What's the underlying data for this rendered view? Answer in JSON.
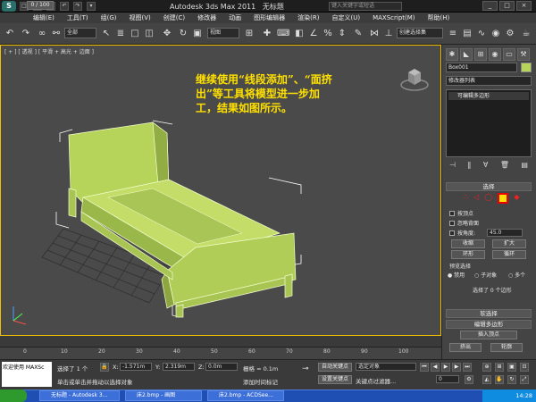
{
  "app": {
    "title": "Autodesk 3ds Max 2011",
    "doc_title": "无标题",
    "search_placeholder": "键入关键字或短语"
  },
  "menu": [
    "编辑(E)",
    "工具(T)",
    "组(G)",
    "视图(V)",
    "创建(C)",
    "修改器",
    "动画",
    "图形编辑器",
    "渲染(R)",
    "自定义(U)",
    "MAXScript(M)",
    "帮助(H)"
  ],
  "toolbar": {
    "filter_select": "全部",
    "coord_select": "视图",
    "selset_select": "创建选择集"
  },
  "viewport": {
    "label": "[ + ] [ 透视 ] [ 平滑 + 高光 + 边面 ]",
    "note_lines": [
      "继续使用“线段添加”、“面挤",
      "出”等工具将模型进一步加",
      "工，结果如图所示。"
    ]
  },
  "timeline": {
    "frame": "0 / 100",
    "ticks": [
      "0",
      "10",
      "20",
      "30",
      "40",
      "50",
      "60",
      "70",
      "80",
      "90",
      "100"
    ]
  },
  "status": {
    "welcome": "欢迎使用 MAXSc",
    "selected": "选择了 1 个",
    "x_label": "X:",
    "x_val": "-1.571m",
    "y_label": "Y:",
    "y_val": "2.319m",
    "z_label": "Z:",
    "z_val": "0.0m",
    "grid": "栅格 = 0.1m",
    "prompt": "单击或单击并拖动以选择对象",
    "add_time_tag": "添加时间标记",
    "auto_key": "自动关键点",
    "set_key": "设置关键点",
    "selected_object": "选定对象",
    "key_filters": "关键点过滤器...",
    "frame_value": "0"
  },
  "panel": {
    "object_name": "Box001",
    "modifier_list": "修改器列表",
    "stack_item": "可编辑多边形",
    "selection_title": "选择",
    "by_vertex": "按顶点",
    "ignore_backface": "忽略背面",
    "by_angle": "按角度:",
    "angle_value": "45.0",
    "shrink": "收缩",
    "grow": "扩大",
    "ring": "环形",
    "loop": "循环",
    "preview_selection": "预览选择",
    "disabled": "禁用",
    "sub_object": "子对象",
    "multi": "多个",
    "selected_count": "选择了 0 个边形",
    "soft_selection": "软选择",
    "edit_poly": "编辑多边形",
    "insert_vertex": "插入顶点",
    "extrude": "挤出",
    "outline": "轮廓"
  },
  "taskbar": {
    "tasks": [
      "无标题 - Autodesk 3...",
      "床2.bmp - 画图",
      "床2.bmp - ACDSee..."
    ],
    "clock": "14:28"
  },
  "colors": {
    "bed": "#b6d35a",
    "note": "#ffe000",
    "viewport_bg": "#4a4a4a",
    "active_border": "#f0c000"
  }
}
